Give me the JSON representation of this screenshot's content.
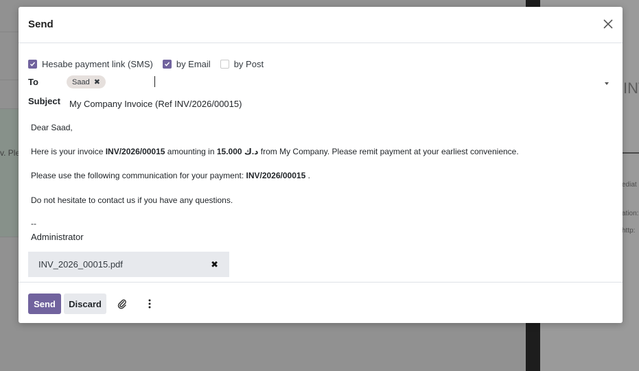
{
  "background": {
    "left_fragment": "v. Plea",
    "right_heading": "INV/",
    "right_small_1": "ediat",
    "right_small_2": "ation:",
    "right_small_3": "http:"
  },
  "modal": {
    "title": "Send",
    "options": [
      {
        "label": "Hesabe payment link (SMS)",
        "checked": true
      },
      {
        "label": "by Email",
        "checked": true
      },
      {
        "label": "by Post",
        "checked": false
      }
    ],
    "to_label": "To",
    "recipients": [
      "Saad"
    ],
    "subject_label": "Subject",
    "subject_value": "My Company Invoice (Ref INV/2026/00015)",
    "body": {
      "greeting": "Dear Saad,",
      "line1_a": "Here is your invoice ",
      "line1_invoice": "INV/2026/00015",
      "line1_b": " amounting in ",
      "line1_amount": "15.000 د.ك",
      "line1_c": " from My Company. Please remit payment at your earliest convenience.",
      "line2_a": "Please use the following communication for your payment: ",
      "line2_ref": "INV/2026/00015",
      "line2_b": " .",
      "line3": "Do not hesitate to contact us if you have any questions.",
      "sig_sep": "--",
      "sig_name": "Administrator"
    },
    "attachment": {
      "name": "INV_2026_00015.pdf"
    },
    "footer": {
      "send_label": "Send",
      "discard_label": "Discard"
    }
  },
  "colors": {
    "accent": "#71639e",
    "secondary_button": "#e7e9ed",
    "tag_bg": "#e6e0dd"
  },
  "icons": {
    "close": "close-icon",
    "tag_remove": "x-icon",
    "attachment_remove": "x-icon",
    "attach": "paperclip-icon",
    "more": "vertical-ellipsis-icon",
    "checkbox": "checkmark-icon",
    "dropdown": "caret-down-icon"
  }
}
